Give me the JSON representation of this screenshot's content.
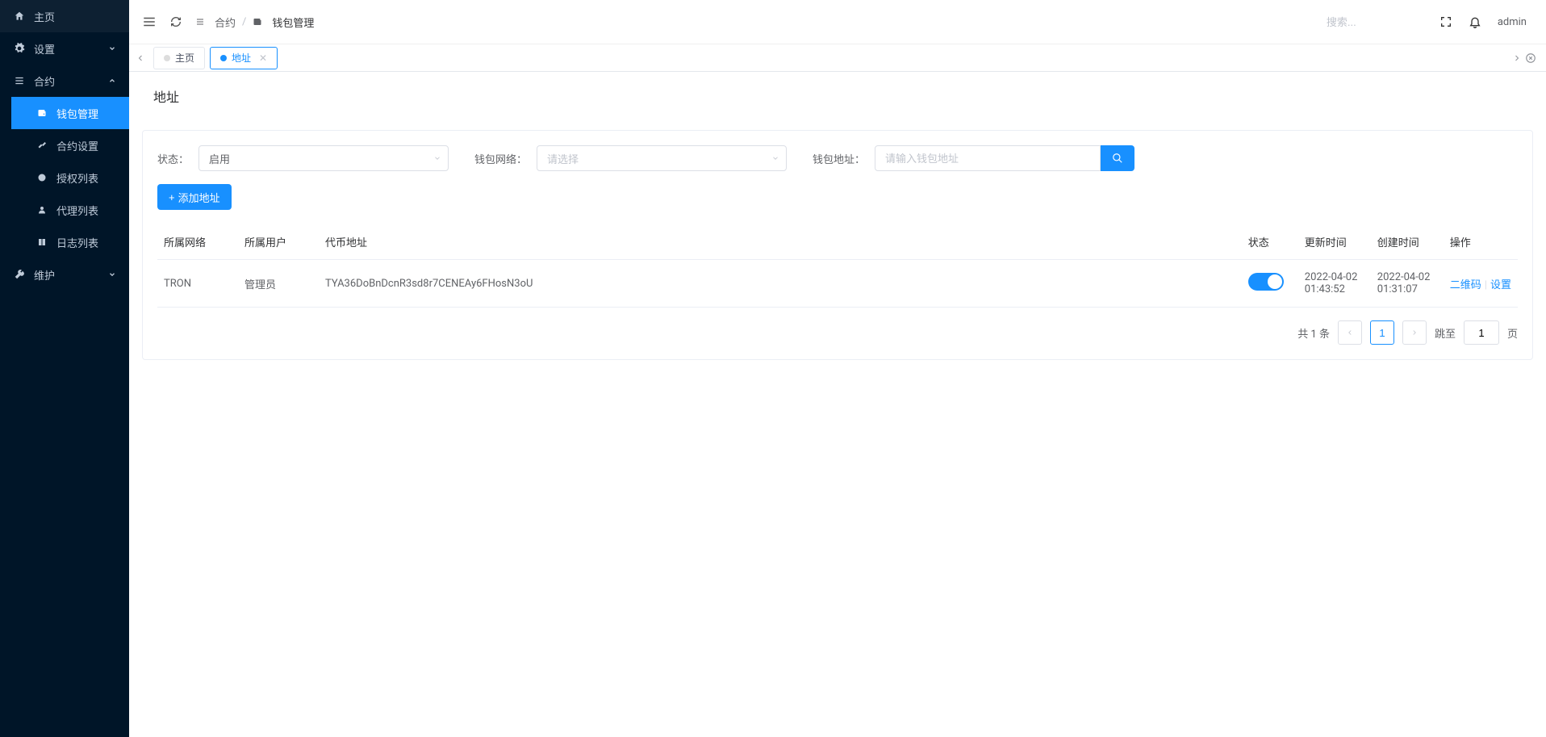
{
  "sidebar": {
    "items": [
      {
        "icon": "home",
        "label": "主页"
      },
      {
        "icon": "gear",
        "label": "设置",
        "expandable": true
      },
      {
        "icon": "contract",
        "label": "合约",
        "expandable": true,
        "expanded": true
      },
      {
        "icon": "wrench",
        "label": "维护",
        "expandable": true
      }
    ],
    "contract_children": [
      {
        "icon": "wallet",
        "label": "钱包管理"
      },
      {
        "icon": "tool",
        "label": "合约设置"
      },
      {
        "icon": "auth",
        "label": "授权列表"
      },
      {
        "icon": "user",
        "label": "代理列表"
      },
      {
        "icon": "book",
        "label": "日志列表"
      }
    ]
  },
  "header": {
    "search_placeholder": "搜索...",
    "user": "admin"
  },
  "breadcrumb": {
    "item1": "合约",
    "item2": "钱包管理"
  },
  "tabs": {
    "tab1": "主页",
    "tab2": "地址"
  },
  "page": {
    "title": "地址"
  },
  "filters": {
    "status_label": "状态：",
    "status_value": "启用",
    "network_label": "钱包网络：",
    "network_placeholder": "请选择",
    "address_label": "钱包地址：",
    "address_placeholder": "请输入钱包地址"
  },
  "buttons": {
    "add_address": "添加地址"
  },
  "table": {
    "headers": {
      "network": "所属网络",
      "user": "所属用户",
      "token_address": "代币地址",
      "status": "状态",
      "update_time": "更新时间",
      "create_time": "创建时间",
      "operation": "操作"
    },
    "rows": [
      {
        "network": "TRON",
        "user": "管理员",
        "token_address": "TYA36DoBnDcnR3sd8r7CENEAy6FHosN3oU",
        "status_on": true,
        "update_time": "2022-04-02 01:43:52",
        "create_time": "2022-04-02 01:31:07",
        "op_qr": "二维码",
        "op_set": "设置"
      }
    ]
  },
  "pagination": {
    "total_text": "共 1 条",
    "current": "1",
    "jump_label": "跳至",
    "jump_value": "1",
    "page_suffix": "页"
  }
}
